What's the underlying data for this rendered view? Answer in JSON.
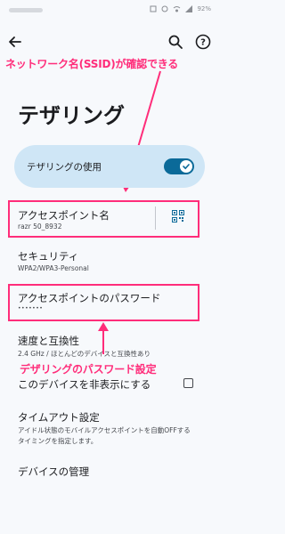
{
  "status_bar": {
    "battery": "92%"
  },
  "app_bar": {
    "back_icon": "arrow-back-icon",
    "search_icon": "search-icon",
    "help_icon": "help-icon"
  },
  "annotations": {
    "top": "ネットワーク名(SSID)が確認できる",
    "middle": "デザリングのパスワード設定",
    "color": "#ff2d7a"
  },
  "page": {
    "title": "テザリング"
  },
  "tethering_card": {
    "label": "テザリングの使用",
    "enabled": true
  },
  "items": {
    "hotspot_name": {
      "title": "アクセスポイント名",
      "value": "razr 50_8932"
    },
    "security": {
      "title": "セキュリティ",
      "value": "WPA2/WPA3-Personal"
    },
    "password": {
      "title": "アクセスポイントのパスワード",
      "value": "•••••••"
    },
    "speed": {
      "title": "速度と互換性",
      "value": "2.4 GHz / ほとんどのデバイスと互換性あり"
    },
    "hide_device": {
      "title": "このデバイスを非表示にする",
      "checked": false
    },
    "timeout": {
      "title": "タイムアウト設定",
      "value_line1": "アイドル状態のモバイルアクセスポイントを自動OFFする",
      "value_line2": "タイミングを指定します。"
    },
    "device_management": {
      "title": "デバイスの管理"
    }
  },
  "colors": {
    "accent": "#0b6a99",
    "card": "#cfe6f6",
    "highlight": "#ff2d7a"
  }
}
